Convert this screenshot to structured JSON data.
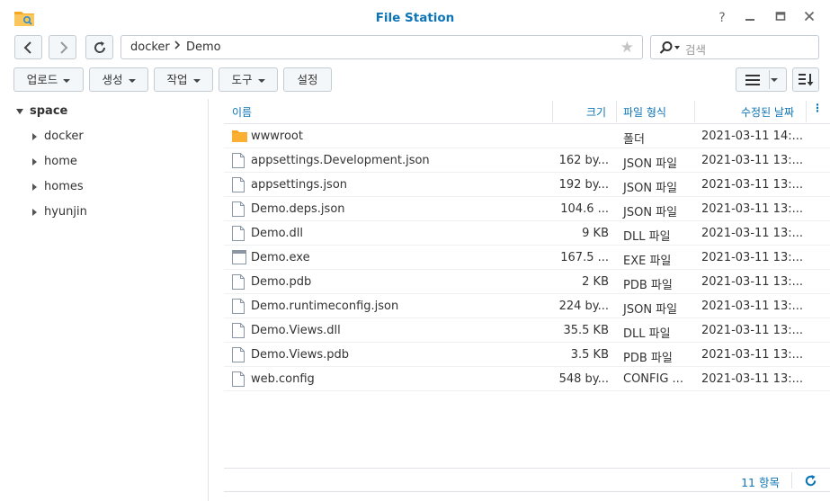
{
  "window": {
    "title": "File Station",
    "icons": [
      "file-station-app-icon",
      "help-icon",
      "minimize-icon",
      "maximize-icon",
      "close-icon"
    ]
  },
  "path": {
    "segments": [
      "docker",
      "Demo"
    ]
  },
  "search": {
    "placeholder": "검색"
  },
  "toolbar": {
    "upload": "업로드",
    "create": "생성",
    "action": "작업",
    "tools": "도구",
    "settings": "설정"
  },
  "sidebar": {
    "root": "space",
    "items": [
      "docker",
      "home",
      "homes",
      "hyunjin"
    ]
  },
  "table": {
    "columns": {
      "name": "이름",
      "size": "크기",
      "type": "파일 형식",
      "modified": "수정된 날짜"
    },
    "rows": [
      {
        "name": "wwwroot",
        "size": "",
        "type": "폴더",
        "modified": "2021-03-11 14:...",
        "icon": "folder"
      },
      {
        "name": "appsettings.Development.json",
        "size": "162 by...",
        "type": "JSON 파일",
        "modified": "2021-03-11 13:...",
        "icon": "file"
      },
      {
        "name": "appsettings.json",
        "size": "192 by...",
        "type": "JSON 파일",
        "modified": "2021-03-11 13:...",
        "icon": "file"
      },
      {
        "name": "Demo.deps.json",
        "size": "104.6 ...",
        "type": "JSON 파일",
        "modified": "2021-03-11 13:...",
        "icon": "file"
      },
      {
        "name": "Demo.dll",
        "size": "9 KB",
        "type": "DLL 파일",
        "modified": "2021-03-11 13:...",
        "icon": "file"
      },
      {
        "name": "Demo.exe",
        "size": "167.5 ...",
        "type": "EXE 파일",
        "modified": "2021-03-11 13:...",
        "icon": "exe"
      },
      {
        "name": "Demo.pdb",
        "size": "2 KB",
        "type": "PDB 파일",
        "modified": "2021-03-11 13:...",
        "icon": "file"
      },
      {
        "name": "Demo.runtimeconfig.json",
        "size": "224 by...",
        "type": "JSON 파일",
        "modified": "2021-03-11 13:...",
        "icon": "file"
      },
      {
        "name": "Demo.Views.dll",
        "size": "35.5 KB",
        "type": "DLL 파일",
        "modified": "2021-03-11 13:...",
        "icon": "file"
      },
      {
        "name": "Demo.Views.pdb",
        "size": "3.5 KB",
        "type": "PDB 파일",
        "modified": "2021-03-11 13:...",
        "icon": "file"
      },
      {
        "name": "web.config",
        "size": "548 by...",
        "type": "CONFIG ...",
        "modified": "2021-03-11 13:...",
        "icon": "file"
      }
    ]
  },
  "footer": {
    "count": "11 항목"
  },
  "colors": {
    "accent": "#0d75b5",
    "folder": "#f5a623"
  }
}
